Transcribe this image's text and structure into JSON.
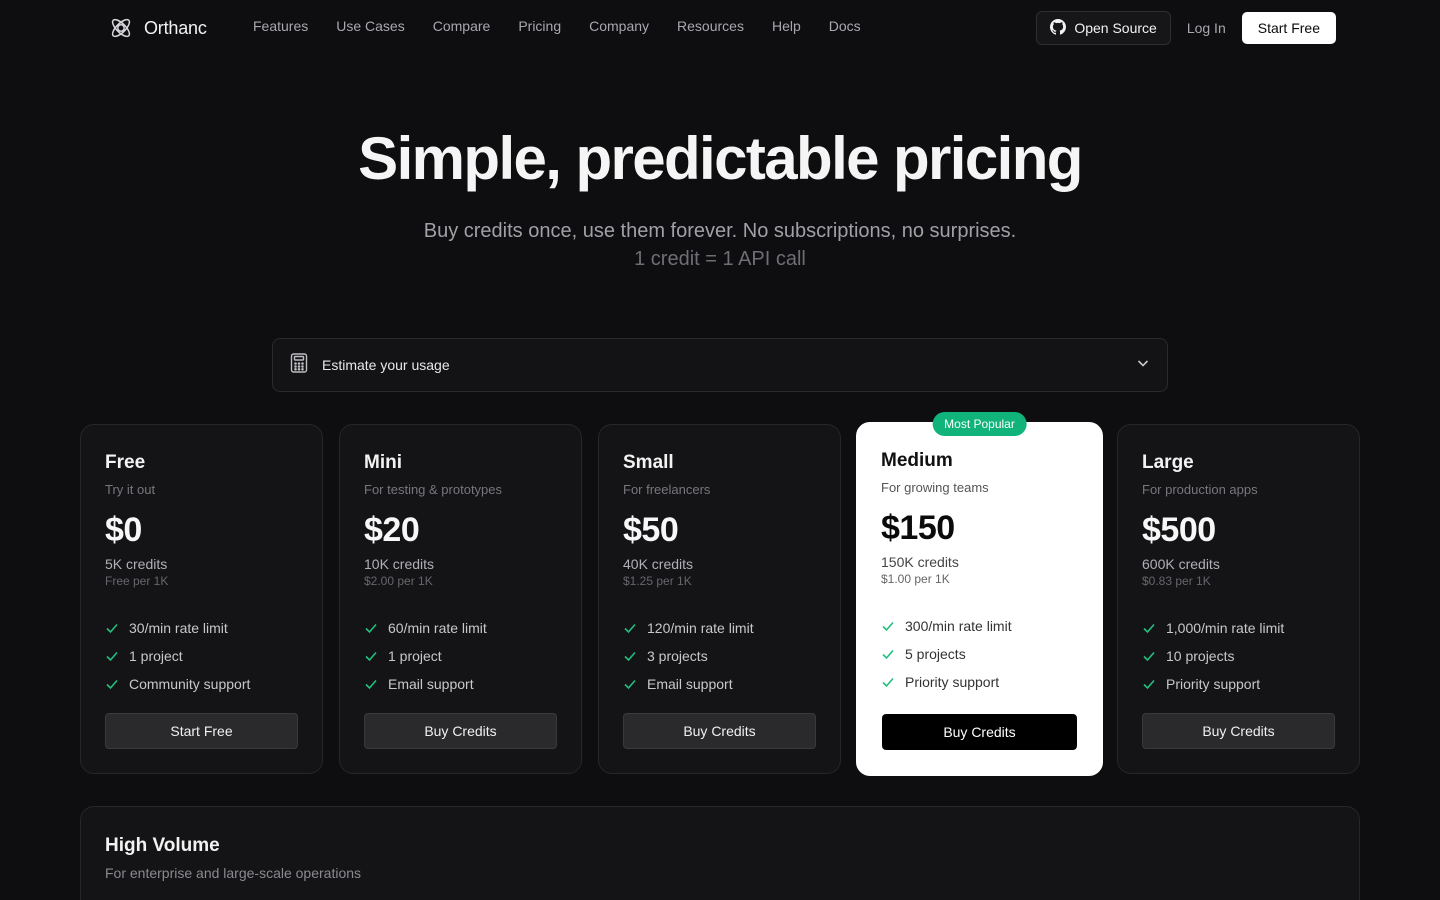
{
  "nav": {
    "brand": "Orthanc",
    "links": [
      "Features",
      "Use Cases",
      "Compare",
      "Pricing",
      "Company",
      "Resources",
      "Help",
      "Docs"
    ],
    "open_source": "Open Source",
    "login": "Log In",
    "start_free": "Start Free"
  },
  "hero": {
    "title": "Simple, predictable pricing",
    "subtitle": "Buy credits once, use them forever. No subscriptions, no surprises.",
    "subtitle2": "1 credit = 1 API call"
  },
  "estimate": {
    "label": "Estimate your usage"
  },
  "plans": [
    {
      "name": "Free",
      "desc": "Try it out",
      "price": "$0",
      "credits": "5K credits",
      "per": "Free per 1K",
      "features": [
        "30/min rate limit",
        "1 project",
        "Community support"
      ],
      "button": "Start Free"
    },
    {
      "name": "Mini",
      "desc": "For testing & prototypes",
      "price": "$20",
      "credits": "10K credits",
      "per": "$2.00 per 1K",
      "features": [
        "60/min rate limit",
        "1 project",
        "Email support"
      ],
      "button": "Buy Credits"
    },
    {
      "name": "Small",
      "desc": "For freelancers",
      "price": "$50",
      "credits": "40K credits",
      "per": "$1.25 per 1K",
      "features": [
        "120/min rate limit",
        "3 projects",
        "Email support"
      ],
      "button": "Buy Credits"
    },
    {
      "name": "Medium",
      "desc": "For growing teams",
      "price": "$150",
      "credits": "150K credits",
      "per": "$1.00 per 1K",
      "features": [
        "300/min rate limit",
        "5 projects",
        "Priority support"
      ],
      "button": "Buy Credits",
      "badge": "Most Popular"
    },
    {
      "name": "Large",
      "desc": "For production apps",
      "price": "$500",
      "credits": "600K credits",
      "per": "$0.83 per 1K",
      "features": [
        "1,000/min rate limit",
        "10 projects",
        "Priority support"
      ],
      "button": "Buy Credits"
    }
  ],
  "high_volume": {
    "title": "High Volume",
    "desc": "For enterprise and large-scale operations"
  },
  "colors": {
    "background": "#0e0e10",
    "accent_green": "#10b37a",
    "check_green": "#22c07f"
  },
  "icons": {
    "brand": "atom-logo-icon",
    "open_source": "github-icon",
    "estimate": "calculator-icon",
    "estimate_toggle": "chevron-down-icon",
    "feature": "check-icon"
  }
}
